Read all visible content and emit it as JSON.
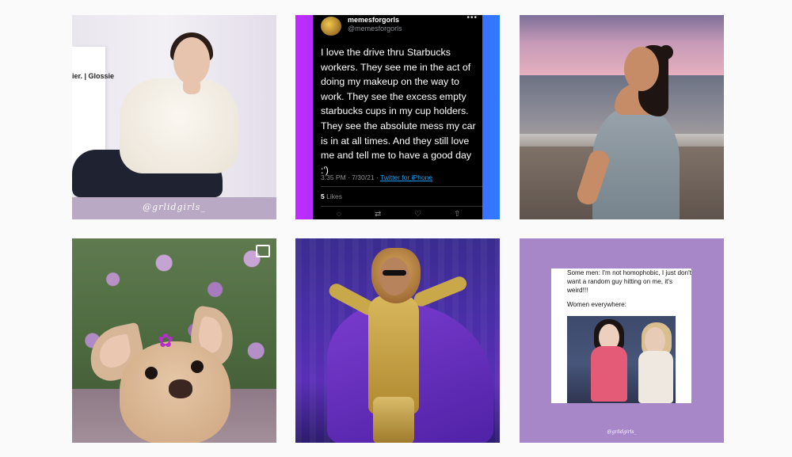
{
  "grid": {
    "posts": [
      {
        "watermark": "@grlidgirls_"
      },
      {
        "tweet": {
          "name": "memesforgorls",
          "handle": "@memesforgorls",
          "more": "•••",
          "text": "I love the drive thru Starbucks workers. They see me in the act of doing my makeup on the way to work. They see the excess empty starbucks cups in my cup holders. They see the absolute mess my car is in at all times. And they still love me and tell me to have a good day :')",
          "time": "3:35 PM · 7/30/21 ·",
          "source": "Twitter for iPhone",
          "likes_count": "5",
          "likes_label": "Likes",
          "actions": [
            "reply-icon",
            "retweet-icon",
            "like-icon",
            "share-icon"
          ]
        }
      },
      {},
      {
        "icon": "video-icon"
      },
      {},
      {
        "meme": {
          "line1": "Some men: I'm not homophobic, I just don't want a random guy hitting on me, it's weird!!!",
          "line2": "Women everywhere:",
          "watermark": "@grlidgirls_"
        }
      }
    ]
  },
  "colors": {
    "tweet_link": "#1d9bf0",
    "meme_bg": "#a887c8",
    "watermark_band": "#b9a9c4"
  }
}
